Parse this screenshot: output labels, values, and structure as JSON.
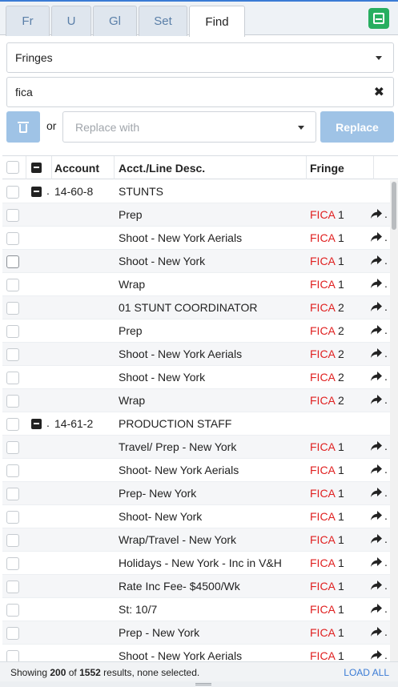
{
  "tabs": [
    {
      "label": "Fr",
      "active": false
    },
    {
      "label": "U",
      "active": false
    },
    {
      "label": "Gl",
      "active": false
    },
    {
      "label": "Set",
      "active": false
    },
    {
      "label": "Find",
      "active": true
    }
  ],
  "filter": {
    "selected": "Fringes"
  },
  "search": {
    "value": "fica"
  },
  "replace": {
    "or_label": "or",
    "placeholder": "Replace with",
    "button_label": "Replace"
  },
  "grid": {
    "headers": {
      "account": "Account",
      "desc": "Acct./Line Desc.",
      "fringe": "Fringe"
    },
    "rows": [
      {
        "type": "group",
        "account": "14-60-8",
        "desc": "STUNTS"
      },
      {
        "type": "item",
        "desc": "Prep",
        "fringe_code": "FICA",
        "fringe_num": "1"
      },
      {
        "type": "item",
        "desc": "Shoot - New York Aerials",
        "fringe_code": "FICA",
        "fringe_num": "1"
      },
      {
        "type": "item",
        "desc": "Shoot - New York",
        "fringe_code": "FICA",
        "fringe_num": "1"
      },
      {
        "type": "item",
        "desc": "Wrap",
        "fringe_code": "FICA",
        "fringe_num": "1"
      },
      {
        "type": "item",
        "desc": "01 STUNT COORDINATOR",
        "fringe_code": "FICA",
        "fringe_num": "2"
      },
      {
        "type": "item",
        "desc": "Prep",
        "fringe_code": "FICA",
        "fringe_num": "2"
      },
      {
        "type": "item",
        "desc": "Shoot - New York Aerials",
        "fringe_code": "FICA",
        "fringe_num": "2"
      },
      {
        "type": "item",
        "desc": "Shoot - New York",
        "fringe_code": "FICA",
        "fringe_num": "2"
      },
      {
        "type": "item",
        "desc": "Wrap",
        "fringe_code": "FICA",
        "fringe_num": "2"
      },
      {
        "type": "group",
        "account": "14-61-2",
        "desc": "PRODUCTION STAFF"
      },
      {
        "type": "item",
        "desc": "Travel/ Prep - New York",
        "fringe_code": "FICA",
        "fringe_num": "1"
      },
      {
        "type": "item",
        "desc": "Shoot- New York Aerials",
        "fringe_code": "FICA",
        "fringe_num": "1"
      },
      {
        "type": "item",
        "desc": "Prep- New York",
        "fringe_code": "FICA",
        "fringe_num": "1"
      },
      {
        "type": "item",
        "desc": "Shoot- New York",
        "fringe_code": "FICA",
        "fringe_num": "1"
      },
      {
        "type": "item",
        "desc": "Wrap/Travel - New York",
        "fringe_code": "FICA",
        "fringe_num": "1"
      },
      {
        "type": "item",
        "desc": "Holidays - New York - Inc in V&H",
        "fringe_code": "FICA",
        "fringe_num": "1"
      },
      {
        "type": "item",
        "desc": "Rate Inc Fee- $4500/Wk",
        "fringe_code": "FICA",
        "fringe_num": "1"
      },
      {
        "type": "item",
        "desc": "St: 10/7",
        "fringe_code": "FICA",
        "fringe_num": "1"
      },
      {
        "type": "item",
        "desc": "Prep - New York",
        "fringe_code": "FICA",
        "fringe_num": "1"
      },
      {
        "type": "item",
        "desc": "Shoot - New York Aerials",
        "fringe_code": "FICA",
        "fringe_num": "1"
      }
    ]
  },
  "status": {
    "prefix": "Showing",
    "shown": "200",
    "of": "of",
    "total": "1552",
    "suffix": "results, none selected.",
    "load_all": "LOAD ALL"
  },
  "colors": {
    "accent": "#3a7bd5",
    "highlight": "#e02020",
    "green": "#27ae60",
    "disabled_button": "#9fc3e6"
  }
}
